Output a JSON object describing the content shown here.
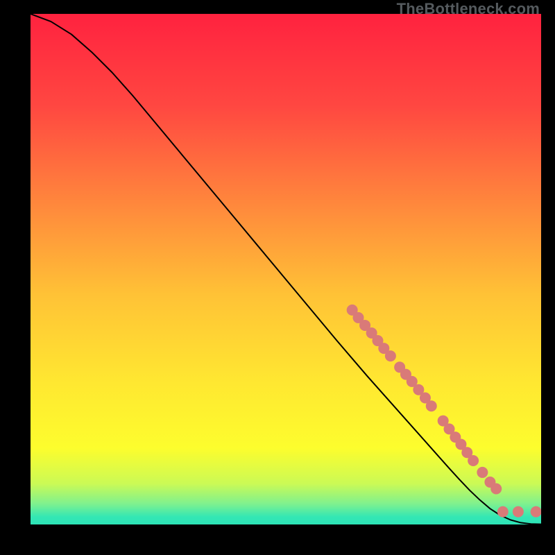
{
  "watermark": "TheBottleneck.com",
  "chart_data": {
    "type": "line",
    "title": "",
    "xlabel": "",
    "ylabel": "",
    "xlim": [
      0,
      100
    ],
    "ylim": [
      0,
      100
    ],
    "background_gradient": {
      "direction": "vertical",
      "stops": [
        {
          "pos": 0.0,
          "color": "#ff223f"
        },
        {
          "pos": 0.18,
          "color": "#ff4741"
        },
        {
          "pos": 0.38,
          "color": "#ff8a3c"
        },
        {
          "pos": 0.55,
          "color": "#ffc236"
        },
        {
          "pos": 0.72,
          "color": "#ffe731"
        },
        {
          "pos": 0.85,
          "color": "#fdfd2d"
        },
        {
          "pos": 0.92,
          "color": "#cbfa55"
        },
        {
          "pos": 0.96,
          "color": "#7ef18f"
        },
        {
          "pos": 0.985,
          "color": "#34e7b4"
        },
        {
          "pos": 1.0,
          "color": "#2de3b7"
        }
      ]
    },
    "series": [
      {
        "name": "bottleneck-curve",
        "color": "#000000",
        "stroke_width": 2,
        "x": [
          0,
          4,
          8,
          12,
          16,
          20,
          25,
          30,
          35,
          40,
          45,
          50,
          55,
          60,
          63,
          66,
          70,
          74,
          78,
          82,
          84,
          86,
          88,
          90,
          92,
          94,
          96,
          98,
          100
        ],
        "y": [
          100,
          98.5,
          96,
          92.5,
          88.5,
          84,
          78,
          72,
          66,
          60,
          54,
          48,
          42,
          36,
          32.5,
          29,
          24.5,
          20,
          15.5,
          11,
          8.8,
          6.7,
          4.8,
          3.1,
          1.8,
          0.9,
          0.35,
          0.1,
          0.05
        ]
      }
    ],
    "markers": {
      "name": "gpu-points",
      "color": "#d97a78",
      "radius": 8,
      "points": [
        {
          "x": 63.0,
          "y": 42.0
        },
        {
          "x": 64.2,
          "y": 40.5
        },
        {
          "x": 65.5,
          "y": 39.0
        },
        {
          "x": 66.8,
          "y": 37.5
        },
        {
          "x": 68.0,
          "y": 36.0
        },
        {
          "x": 69.2,
          "y": 34.5
        },
        {
          "x": 70.5,
          "y": 33.0
        },
        {
          "x": 72.3,
          "y": 30.8
        },
        {
          "x": 73.5,
          "y": 29.4
        },
        {
          "x": 74.7,
          "y": 28.0
        },
        {
          "x": 76.0,
          "y": 26.4
        },
        {
          "x": 77.3,
          "y": 24.8
        },
        {
          "x": 78.5,
          "y": 23.2
        },
        {
          "x": 80.8,
          "y": 20.3
        },
        {
          "x": 82.0,
          "y": 18.7
        },
        {
          "x": 83.2,
          "y": 17.1
        },
        {
          "x": 84.3,
          "y": 15.7
        },
        {
          "x": 85.5,
          "y": 14.1
        },
        {
          "x": 86.7,
          "y": 12.5
        },
        {
          "x": 88.5,
          "y": 10.2
        },
        {
          "x": 90.0,
          "y": 8.3
        },
        {
          "x": 91.2,
          "y": 7.0
        },
        {
          "x": 92.5,
          "y": 2.5
        },
        {
          "x": 95.5,
          "y": 2.5
        },
        {
          "x": 99.0,
          "y": 2.5
        }
      ]
    }
  }
}
